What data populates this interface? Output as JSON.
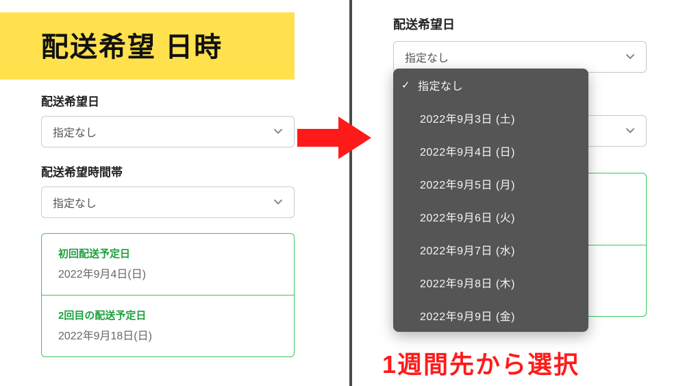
{
  "left": {
    "title": "配送希望 日時",
    "date_label": "配送希望日",
    "date_value": "指定なし",
    "time_label": "配送希望時間帯",
    "time_value": "指定なし",
    "schedule": [
      {
        "label": "初回配送予定日",
        "value": "2022年9月4日(日)"
      },
      {
        "label": "2回目の配送予定日",
        "value": "2022年9月18日(日)"
      }
    ]
  },
  "right": {
    "date_label": "配送希望日",
    "date_value": "指定なし",
    "dropdown": {
      "selected": "指定なし",
      "options": [
        "2022年9月3日 (土)",
        "2022年9月4日 (日)",
        "2022年9月5日 (月)",
        "2022年9月6日 (火)",
        "2022年9月7日 (水)",
        "2022年9月8日 (木)",
        "2022年9月9日 (金)"
      ]
    },
    "caption": "1週間先から選択"
  },
  "icons": {
    "chevron": "chevron-down-icon",
    "check": "✓"
  },
  "colors": {
    "accent_green": "#35c759",
    "title_bg": "#ffe14d",
    "arrow_red": "#ff1a1a",
    "dropdown_bg": "#555555"
  }
}
